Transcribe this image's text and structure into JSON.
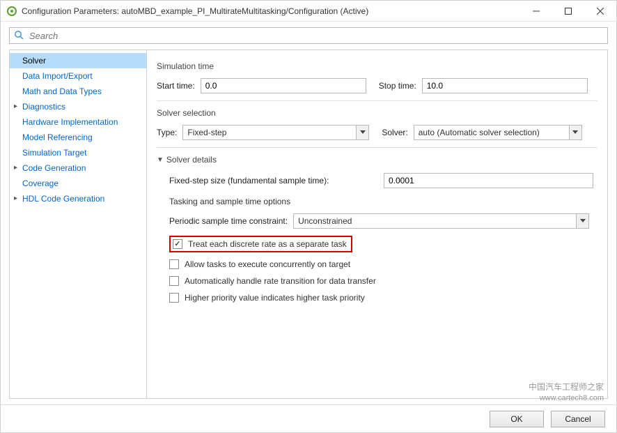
{
  "window": {
    "title": "Configuration Parameters: autoMBD_example_PI_MultirateMultitasking/Configuration (Active)"
  },
  "search": {
    "placeholder": "Search"
  },
  "nav": {
    "items": [
      {
        "label": "Solver",
        "selected": true
      },
      {
        "label": "Data Import/Export"
      },
      {
        "label": "Math and Data Types"
      },
      {
        "label": "Diagnostics",
        "expandable": true
      },
      {
        "label": "Hardware Implementation"
      },
      {
        "label": "Model Referencing"
      },
      {
        "label": "Simulation Target"
      },
      {
        "label": "Code Generation",
        "expandable": true
      },
      {
        "label": "Coverage"
      },
      {
        "label": "HDL Code Generation",
        "expandable": true
      }
    ]
  },
  "simTime": {
    "title": "Simulation time",
    "startLabel": "Start time:",
    "startValue": "0.0",
    "stopLabel": "Stop time:",
    "stopValue": "10.0"
  },
  "solverSel": {
    "title": "Solver selection",
    "typeLabel": "Type:",
    "typeValue": "Fixed-step",
    "solverLabel": "Solver:",
    "solverValue": "auto (Automatic solver selection)"
  },
  "details": {
    "title": "Solver details",
    "fixedStepLabel": "Fixed-step size (fundamental sample time):",
    "fixedStepValue": "0.0001",
    "taskingTitle": "Tasking and sample time options",
    "constraintLabel": "Periodic sample time constraint:",
    "constraintValue": "Unconstrained",
    "chk1": "Treat each discrete rate as a separate task",
    "chk2": "Allow tasks to execute concurrently on target",
    "chk3": "Automatically handle rate transition for data transfer",
    "chk4": "Higher priority value indicates higher task priority"
  },
  "footer": {
    "ok": "OK",
    "cancel": "Cancel"
  },
  "watermark": {
    "line1": "中国汽车工程师之家",
    "line2": "www.cartech8.com"
  }
}
